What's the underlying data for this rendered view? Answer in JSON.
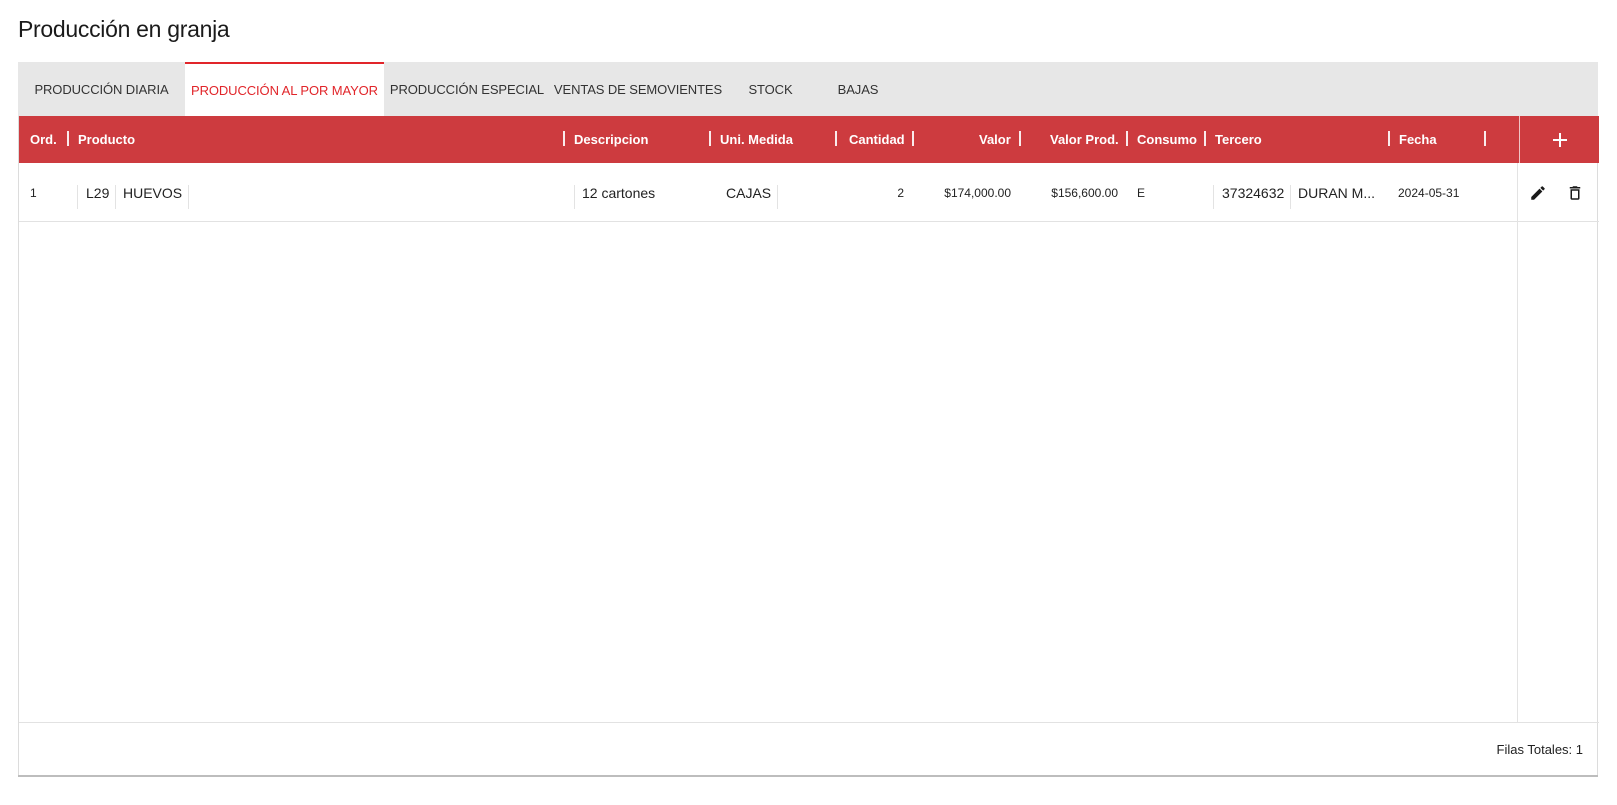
{
  "page_title": "Producción en granja",
  "tabs": [
    {
      "label": "PRODUCCIÓN DIARIA",
      "active": false
    },
    {
      "label": "PRODUCCIÓN AL POR MAYOR",
      "active": true
    },
    {
      "label": "PRODUCCIÓN ESPECIAL",
      "active": false
    },
    {
      "label": "VENTAS DE SEMOVIENTES",
      "active": false
    },
    {
      "label": "STOCK",
      "active": false
    },
    {
      "label": "BAJAS",
      "active": false
    }
  ],
  "table": {
    "columns": [
      "Ord.",
      "Producto",
      "Descripcion",
      "Uni. Medida",
      "Cantidad",
      "Valor",
      "Valor Prod.",
      "Consumo",
      "Tercero",
      "Fecha"
    ],
    "add_icon": "plus-icon",
    "rows": [
      {
        "ord": "1",
        "producto_code": "L29",
        "producto_name": "HUEVOS",
        "descripcion": "12 cartones",
        "uni_medida": "CAJAS",
        "cantidad": "2",
        "valor": "$174,000.00",
        "valor_prod": "$156,600.00",
        "consumo": "E",
        "tercero_id": "37324632",
        "tercero_name": "DURAN M...",
        "fecha": "2024-05-31",
        "edit_icon": "pencil-icon",
        "delete_icon": "trash-icon"
      }
    ]
  },
  "footer": {
    "total_rows": "Filas Totales: 1"
  },
  "colors": {
    "accent": "#e1252a",
    "header_bg": "#cd3b3f",
    "tabs_bg": "#e7e7e7"
  }
}
